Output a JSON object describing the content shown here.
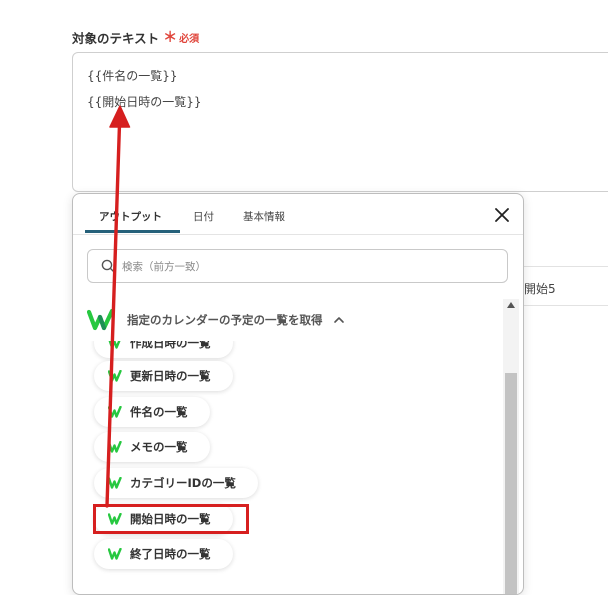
{
  "field": {
    "label": "対象のテキスト",
    "required_mark": "＊",
    "required_text": "必須",
    "lines": [
      "{{件名の一覧}}",
      "{{開始日時の一覧}}"
    ]
  },
  "background": {
    "cell_text": "開始5"
  },
  "popup": {
    "tabs": [
      {
        "label": "アウトプット",
        "active": true
      },
      {
        "label": "日付",
        "active": false
      },
      {
        "label": "基本情報",
        "active": false
      }
    ],
    "search": {
      "placeholder": "検索（前方一致）",
      "value": ""
    },
    "group": {
      "title": "指定のカレンダーの予定の一覧を取得",
      "expanded": true
    },
    "items": [
      {
        "label": "作成日時の一覧"
      },
      {
        "label": "更新日時の一覧"
      },
      {
        "label": "件名の一覧"
      },
      {
        "label": "メモの一覧"
      },
      {
        "label": "カテゴリーIDの一覧"
      },
      {
        "label": "開始日時の一覧",
        "highlighted": true
      },
      {
        "label": "終了日時の一覧"
      }
    ]
  },
  "colors": {
    "brand_green": "#27c840",
    "tab_underline": "#26617a",
    "highlight_red": "#d61f1f",
    "required_red": "#e0463c"
  }
}
